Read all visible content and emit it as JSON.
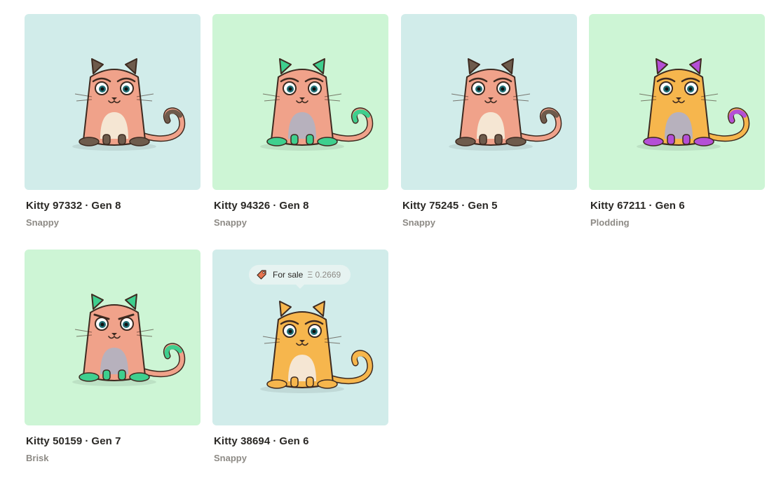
{
  "kitties": [
    {
      "name": "Kitty 97332",
      "gen": "Gen 8",
      "speed": "Snappy",
      "background": "#d1ecea",
      "body": "#f0a28a",
      "belly": "#f5e6d3",
      "accent": "#6e5b4c",
      "eyebrow_angry": false
    },
    {
      "name": "Kitty 94326",
      "gen": "Gen 8",
      "speed": "Snappy",
      "background": "#cdf5d5",
      "body": "#f0a28a",
      "belly": "#b7b1bd",
      "accent": "#3ecf8e",
      "eyebrow_angry": false
    },
    {
      "name": "Kitty 75245",
      "gen": "Gen 5",
      "speed": "Snappy",
      "background": "#d1ecea",
      "body": "#f0a28a",
      "belly": "#f5e6d3",
      "accent": "#6e5b4c",
      "eyebrow_angry": false
    },
    {
      "name": "Kitty 67211",
      "gen": "Gen 6",
      "speed": "Plodding",
      "background": "#cdf5d5",
      "body": "#f6b64d",
      "belly": "#b7b1bd",
      "accent": "#b44fd6",
      "eyebrow_angry": false
    },
    {
      "name": "Kitty 50159",
      "gen": "Gen 7",
      "speed": "Brisk",
      "background": "#cdf5d5",
      "body": "#f0a28a",
      "belly": "#b7b1bd",
      "accent": "#3ecf8e",
      "eyebrow_angry": true
    },
    {
      "name": "Kitty 38694",
      "gen": "Gen 6",
      "speed": "Snappy",
      "background": "#d1ecea",
      "body": "#f6b64d",
      "belly": "#f5e6d3",
      "accent": "#f6b64d",
      "eyebrow_angry": false
    }
  ],
  "sale": {
    "label": "For sale",
    "price": "Ξ 0.2669",
    "icon": "price-tag-icon",
    "icon_color": "#e8744f"
  },
  "separator": "·"
}
